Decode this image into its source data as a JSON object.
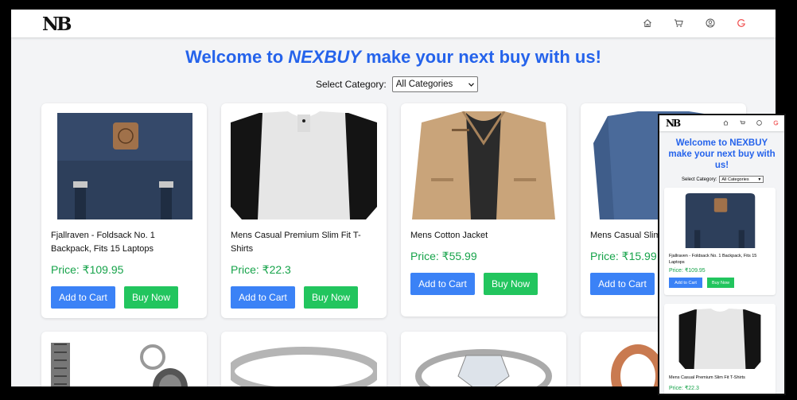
{
  "brand": {
    "logo": "NB"
  },
  "nav": {
    "icons": [
      "home-icon",
      "cart-icon",
      "user-icon",
      "logout-icon"
    ]
  },
  "hero": {
    "prefix": "Welcome to ",
    "brand": "NEXBUY",
    "suffix": " make your next buy with us!"
  },
  "filter": {
    "label": "Select Category:",
    "selected": "All Categories"
  },
  "products": [
    {
      "name": "Fjallraven - Foldsack No. 1 Backpack, Fits 15 Laptops",
      "price": "Price: ₹109.95"
    },
    {
      "name": "Mens Casual Premium Slim Fit T-Shirts",
      "price": "Price: ₹22.3"
    },
    {
      "name": "Mens Cotton Jacket",
      "price": "Price: ₹55.99"
    },
    {
      "name": "Mens Casual Slim",
      "price": "Price: ₹15.99"
    }
  ],
  "buttons": {
    "add_to_cart": "Add to Cart",
    "buy_now": "Buy Now"
  },
  "mobile": {
    "title_line1": "Welcome to NEXBUY",
    "title_line2": "make your next buy with",
    "title_line3": "us!",
    "filter_label": "Select Category:",
    "filter_selected": "All Categories",
    "product1_name": "Fjallraven - Foldsack No. 1 Backpack, Fits 15 Laptops",
    "product1_price": "Price: ₹109.95",
    "product2_name": "Mens Casual Premium Slim Fit T-Shirts",
    "product2_price": "Price: ₹22.3"
  },
  "colors": {
    "accent": "#2563eb",
    "cart_button": "#3b82f6",
    "buy_button": "#22c55e",
    "price": "#16a34a",
    "logout_icon": "#ef4444"
  }
}
